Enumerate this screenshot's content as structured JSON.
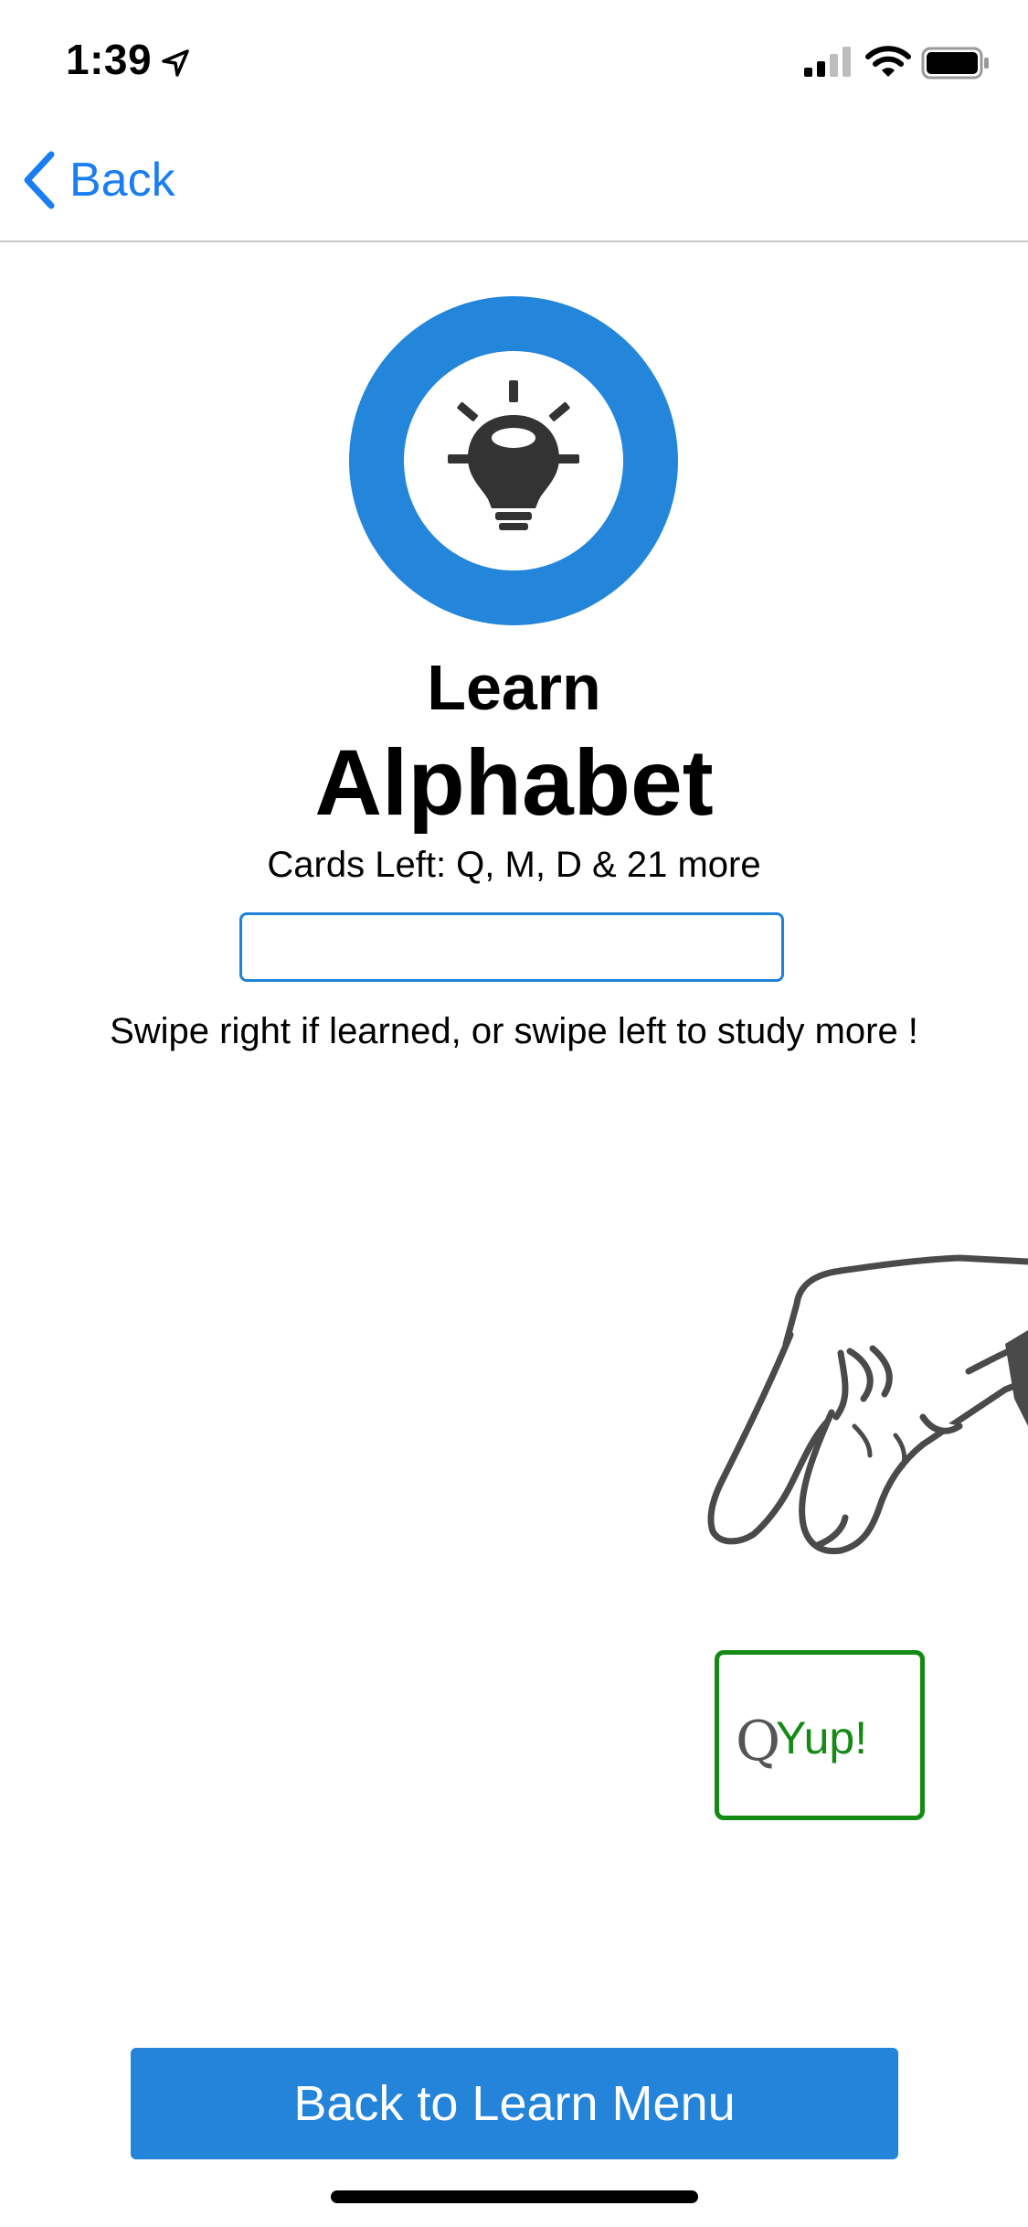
{
  "status_bar": {
    "time": "1:39",
    "icons": [
      "location-arrow-icon",
      "signal-icon",
      "wifi-icon",
      "battery-icon"
    ]
  },
  "nav": {
    "back_label": "Back",
    "back_icon": "chevron-left-icon"
  },
  "header": {
    "logo_icon": "lightbulb-icon",
    "title_small": "Learn",
    "title_large": "Alphabet",
    "cards_left": "Cards Left: Q, M, D & 21 more"
  },
  "answer": {
    "value": "",
    "placeholder": ""
  },
  "instructions": "Swipe right if learned, or swipe left to study more !",
  "card": {
    "image_icon": "hand-sign-q-icon",
    "letter": "Q",
    "stamp_label": "Yup!"
  },
  "footer": {
    "menu_button_label": "Back to Learn Menu"
  },
  "colors": {
    "accent": "#1a7ef2",
    "button_blue": "#2384d9",
    "logo_blue": "#2386db",
    "stamp_green": "#138a13"
  }
}
